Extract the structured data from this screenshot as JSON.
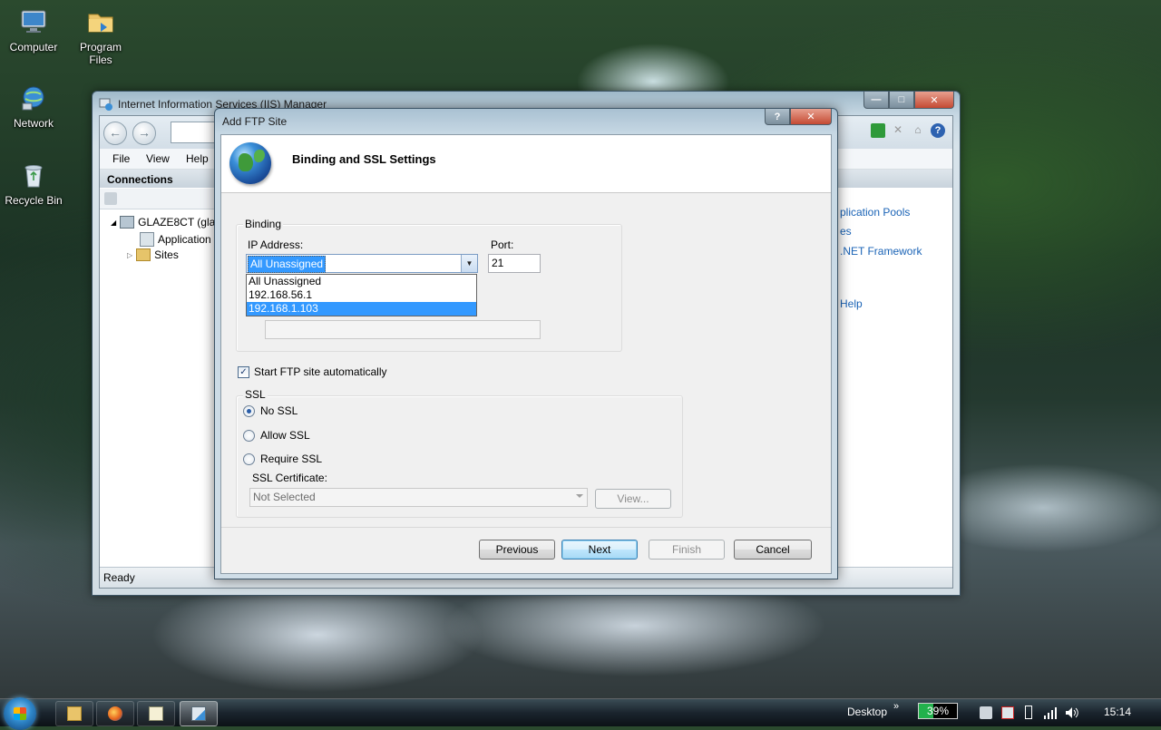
{
  "desktop": {
    "icons": [
      {
        "label": "Computer",
        "icon": "computer-icon"
      },
      {
        "label": "Program Files",
        "icon": "folder-icon"
      },
      {
        "label": "Network",
        "icon": "network-icon"
      },
      {
        "label": "Recycle Bin",
        "icon": "recycle-bin-icon"
      }
    ]
  },
  "iis_window": {
    "title": "Internet Information Services (IIS) Manager",
    "menu": [
      "File",
      "View",
      "Help"
    ],
    "connections_header": "Connections",
    "tree": {
      "server": "GLAZE8CT (glaz",
      "app_pools": "Application",
      "sites": "Sites"
    },
    "actions": {
      "items": [
        "plication Pools",
        "es",
        ".NET Framework",
        "Help"
      ]
    },
    "status": "Ready"
  },
  "dialog": {
    "title": "Add FTP Site",
    "header": "Binding and SSL Settings",
    "binding": {
      "group_label": "Binding",
      "ip_label": "IP Address:",
      "ip_value": "All Unassigned",
      "ip_options": [
        "All Unassigned",
        "192.168.56.1",
        "192.168.1.103"
      ],
      "highlighted_option": "192.168.1.103",
      "port_label": "Port:",
      "port_value": "21"
    },
    "start_automatically": {
      "label": "Start FTP site automatically",
      "checked": true
    },
    "ssl": {
      "group_label": "SSL",
      "options": [
        "No SSL",
        "Allow SSL",
        "Require SSL"
      ],
      "selected": "No SSL",
      "cert_label": "SSL Certificate:",
      "cert_value": "Not Selected",
      "view_label": "View..."
    },
    "buttons": {
      "previous": "Previous",
      "next": "Next",
      "finish": "Finish",
      "cancel": "Cancel"
    }
  },
  "taskbar": {
    "desktop_label": "Desktop",
    "battery": "39%",
    "battery_level": 0.39,
    "clock": "15:14"
  }
}
